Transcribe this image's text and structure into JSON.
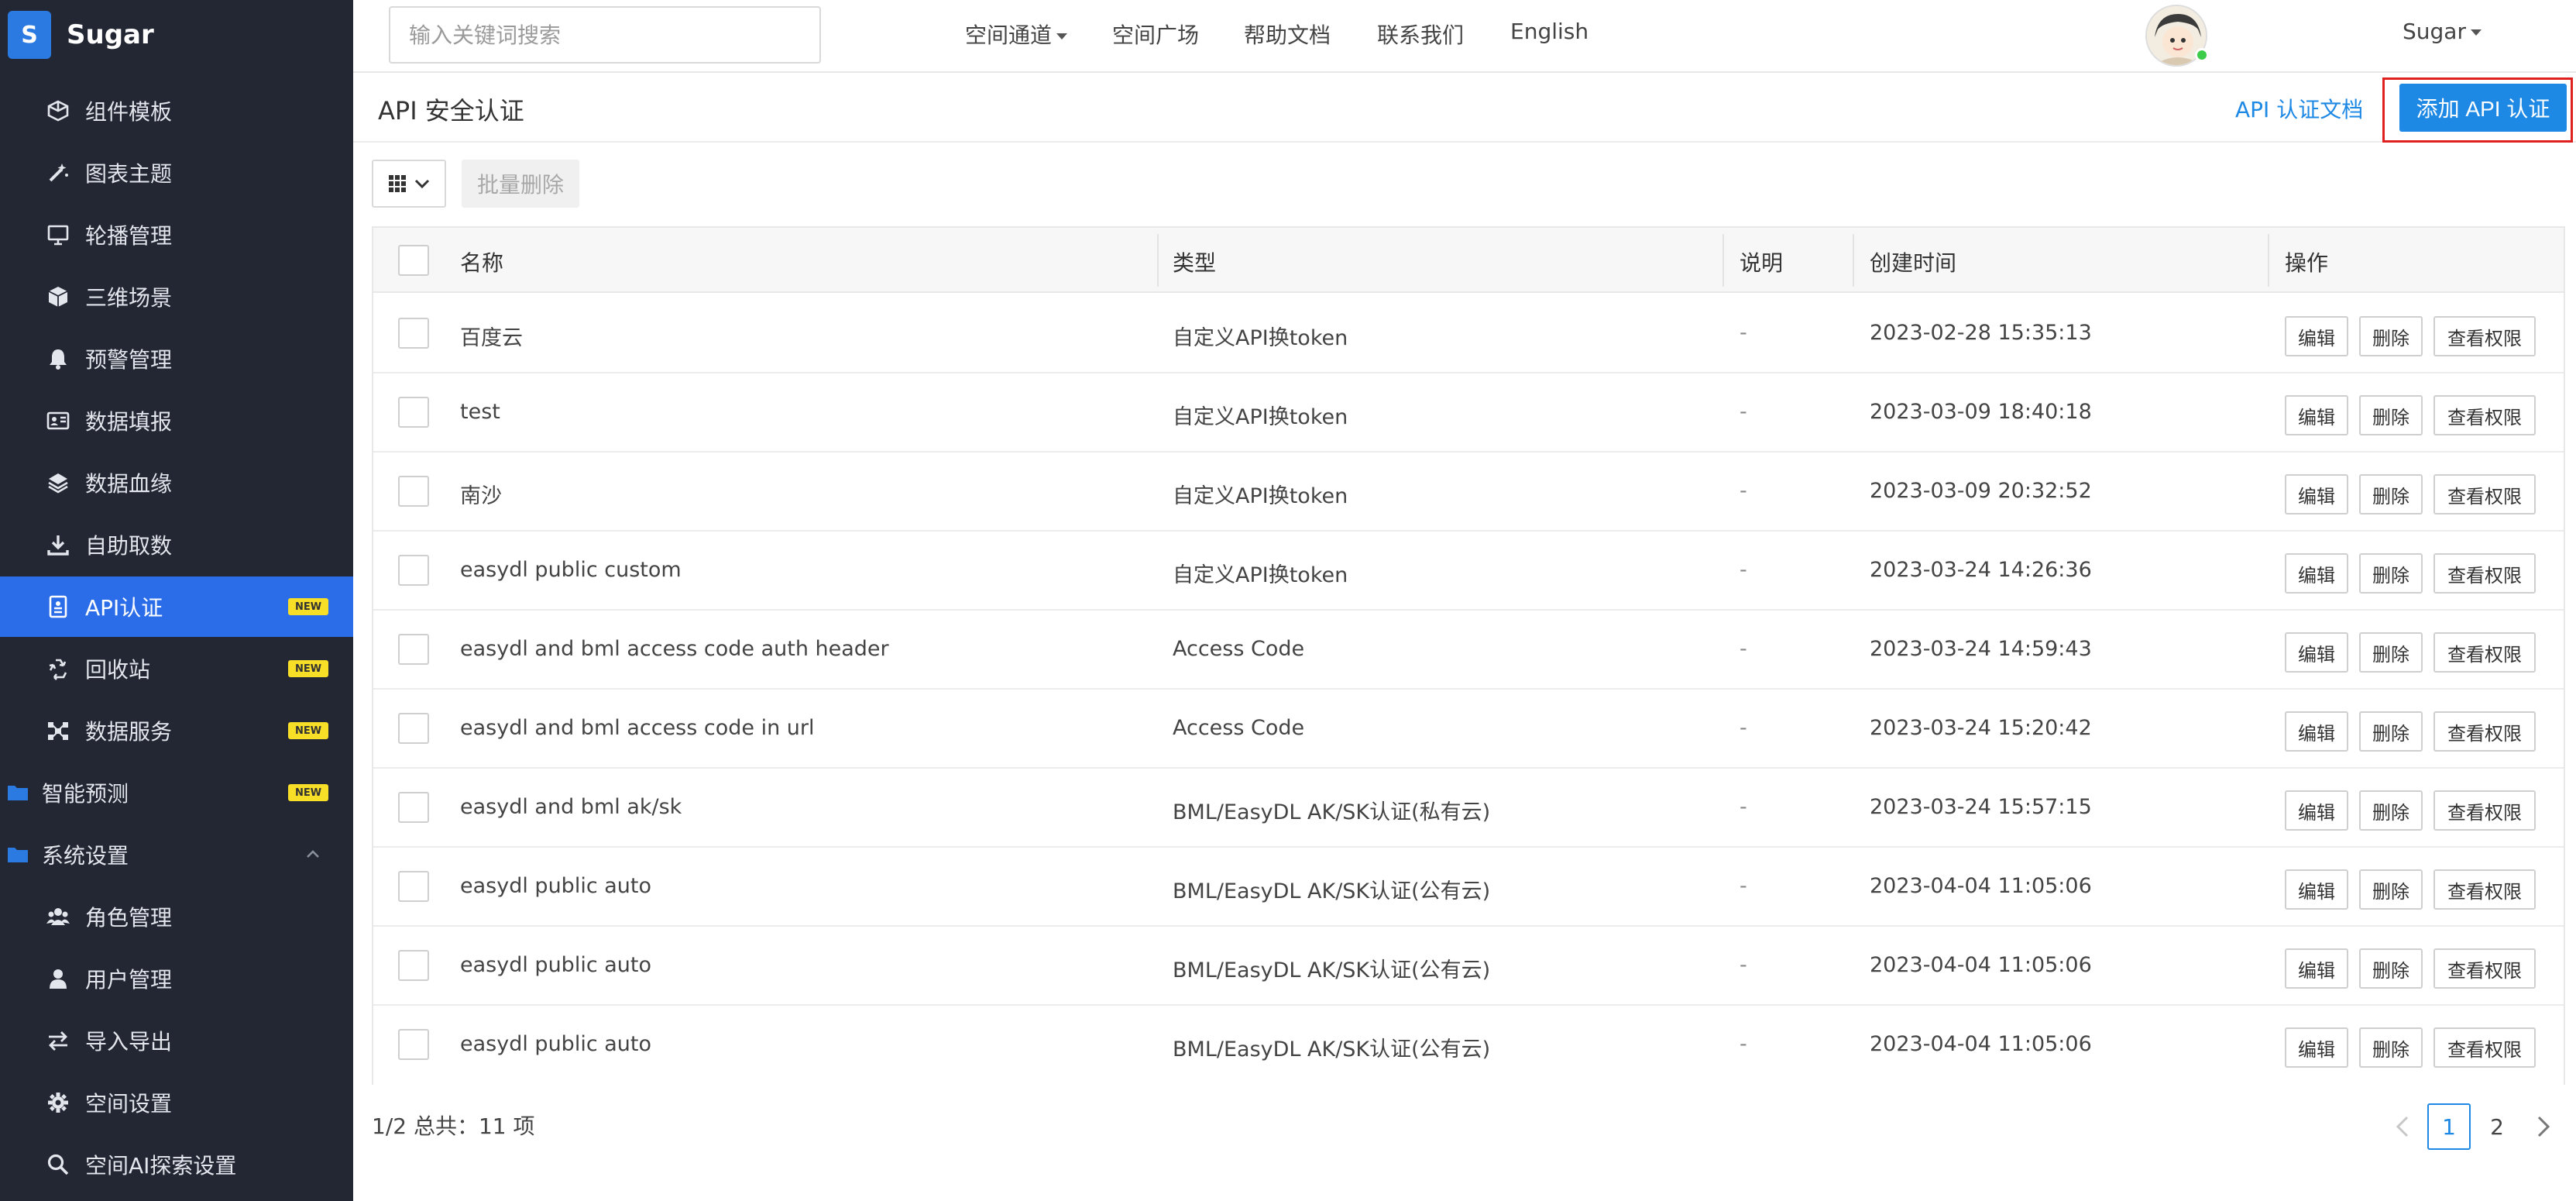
{
  "brand": {
    "logo_letter": "S",
    "name": "Sugar"
  },
  "sidebar": {
    "items": [
      {
        "label": "组件模板",
        "icon": "component-icon",
        "level": 2,
        "badge": ""
      },
      {
        "label": "图表主题",
        "icon": "magic-wand-icon",
        "level": 2,
        "badge": ""
      },
      {
        "label": "轮播管理",
        "icon": "monitor-icon",
        "level": 2,
        "badge": ""
      },
      {
        "label": "三维场景",
        "icon": "cube-icon",
        "level": 2,
        "badge": ""
      },
      {
        "label": "预警管理",
        "icon": "bell-icon",
        "level": 2,
        "badge": ""
      },
      {
        "label": "数据填报",
        "icon": "id-card-icon",
        "level": 2,
        "badge": ""
      },
      {
        "label": "数据血缘",
        "icon": "layers-icon",
        "level": 2,
        "badge": ""
      },
      {
        "label": "自助取数",
        "icon": "download-icon",
        "level": 2,
        "badge": ""
      },
      {
        "label": "API认证",
        "icon": "document-badge-icon",
        "level": 2,
        "badge": "NEW",
        "active": true
      },
      {
        "label": "回收站",
        "icon": "recycle-icon",
        "level": 2,
        "badge": "NEW"
      },
      {
        "label": "数据服务",
        "icon": "network-icon",
        "level": 2,
        "badge": "NEW"
      },
      {
        "label": "智能预测",
        "icon": "folder-icon",
        "level": 1,
        "badge": "NEW"
      },
      {
        "label": "系统设置",
        "icon": "folder-icon",
        "level": 1,
        "badge": ""
      },
      {
        "label": "角色管理",
        "icon": "users-icon",
        "level": 2,
        "badge": ""
      },
      {
        "label": "用户管理",
        "icon": "user-icon",
        "level": 2,
        "badge": ""
      },
      {
        "label": "导入导出",
        "icon": "exchange-icon",
        "level": 2,
        "badge": ""
      },
      {
        "label": "空间设置",
        "icon": "gear-icon",
        "level": 2,
        "badge": ""
      },
      {
        "label": "空间AI探索设置",
        "icon": "search-icon",
        "level": 2,
        "badge": ""
      }
    ]
  },
  "topbar": {
    "search_placeholder": "输入关键词搜索",
    "links": {
      "space_channel": "空间通道",
      "space_plaza": "空间广场",
      "help_docs": "帮助文档",
      "contact_us": "联系我们",
      "language": "English",
      "user": "Sugar"
    }
  },
  "page": {
    "title": "API 安全认证",
    "doc_link": "API 认证文档",
    "add_button": "添加 API 认证"
  },
  "toolbar": {
    "bulk_delete": "批量删除"
  },
  "table": {
    "headers": {
      "name": "名称",
      "type": "类型",
      "desc": "说明",
      "created": "创建时间",
      "ops": "操作"
    },
    "action_labels": {
      "edit": "编辑",
      "delete": "删除",
      "perm": "查看权限"
    },
    "rows": [
      {
        "name": "百度云",
        "type": "自定义API换token",
        "desc": "-",
        "created": "2023-02-28 15:35:13"
      },
      {
        "name": "test",
        "type": "自定义API换token",
        "desc": "-",
        "created": "2023-03-09 18:40:18"
      },
      {
        "name": "南沙",
        "type": "自定义API换token",
        "desc": "-",
        "created": "2023-03-09 20:32:52"
      },
      {
        "name": "easydl public custom",
        "type": "自定义API换token",
        "desc": "-",
        "created": "2023-03-24 14:26:36"
      },
      {
        "name": "easydl and bml access code auth header",
        "type": "Access Code",
        "desc": "-",
        "created": "2023-03-24 14:59:43"
      },
      {
        "name": "easydl and bml access code in url",
        "type": "Access Code",
        "desc": "-",
        "created": "2023-03-24 15:20:42"
      },
      {
        "name": "easydl and bml ak/sk",
        "type": "BML/EasyDL AK/SK认证(私有云)",
        "desc": "-",
        "created": "2023-03-24 15:57:15"
      },
      {
        "name": "easydl public auto",
        "type": "BML/EasyDL AK/SK认证(公有云)",
        "desc": "-",
        "created": "2023-04-04 11:05:06"
      },
      {
        "name": "easydl public auto",
        "type": "BML/EasyDL AK/SK认证(公有云)",
        "desc": "-",
        "created": "2023-04-04 11:05:06"
      },
      {
        "name": "easydl public auto",
        "type": "BML/EasyDL AK/SK认证(公有云)",
        "desc": "-",
        "created": "2023-04-04 11:05:06"
      }
    ]
  },
  "footer": {
    "summary": "1/2 总共：11 项",
    "pages": [
      "1",
      "2"
    ],
    "current_page": "1"
  },
  "colors": {
    "sidebar_bg": "#222733",
    "active_item": "#2b6de8",
    "primary": "#1e88e5",
    "badge": "#f7de27",
    "highlight_frame": "#e0201f"
  }
}
